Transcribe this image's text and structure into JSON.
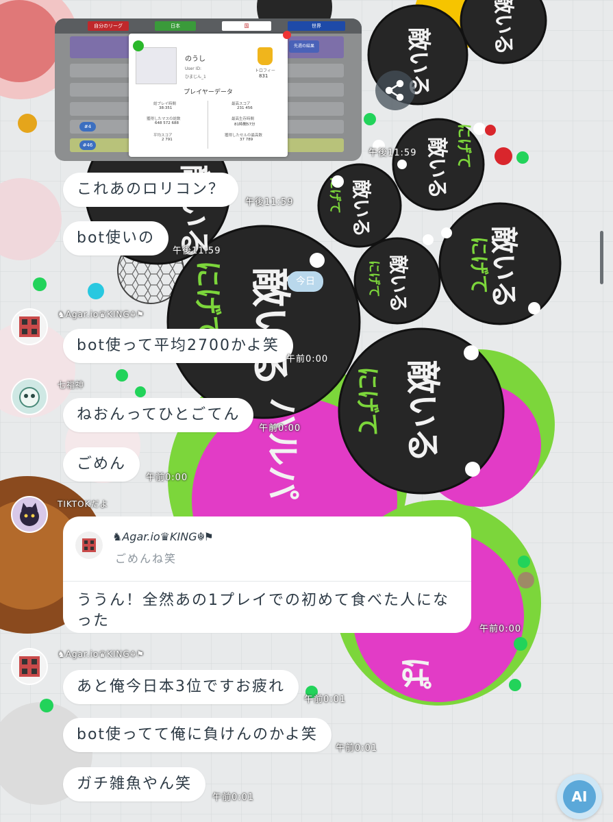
{
  "colors": {
    "bubble_bg": "#ffffff",
    "bubble_text": "#2d3a45",
    "enemy_cell": "#262626",
    "green_cell": "#7cd63b",
    "magenta": "#e23cc6",
    "ai_button": "#5ba8d9"
  },
  "background": {
    "cell_label": "敵いる",
    "cell_sub": "にげて",
    "cell_sub2": "ハルパ"
  },
  "screenshot": {
    "tabs": [
      "自分のリーグ",
      "日本",
      "国",
      "世界"
    ],
    "popup": {
      "name": "のうし",
      "user_id_label": "User ID:",
      "user_id_value": "ひまじん_1",
      "trophy_label": "トロフィー",
      "trophy_value": "831",
      "title": "プレイヤーデータ",
      "stats": [
        {
          "label": "総プレイ時間",
          "value": "38:351"
        },
        {
          "label": "最高スコア",
          "value": "231 456"
        },
        {
          "label": "獲得したマスの総数",
          "value": "648 572 688"
        },
        {
          "label": "最高生存時間",
          "value": "81時間57分"
        },
        {
          "label": "平均スコア",
          "value": "2 791"
        },
        {
          "label": "獲得したセルの最高数",
          "value": "37 789"
        }
      ]
    },
    "ranks": [
      "#4",
      "#46"
    ],
    "side_label": "先週の結果"
  },
  "messages": {
    "m1": {
      "text": "これあのロリコン？",
      "time": "午後11:59"
    },
    "shot_time": "午後11:59",
    "m2": {
      "text": "bot使いの",
      "time": "午後11:59"
    },
    "date_sep": "今日",
    "m3": {
      "sender": "♞Agar.io♛KING☬⚑",
      "text": "bot使って平均2700かよ笑",
      "time": "午前0:00"
    },
    "m4": {
      "sender": "七福神",
      "text": "ねおんってひとごてん",
      "time": "午前0:00"
    },
    "m5": {
      "text": "ごめん",
      "time": "午前0:00"
    },
    "m6": {
      "sender": "TIKTOKだよ",
      "quote_name": "♞Agar.io♛KING☬⚑",
      "quote_text": "ごめんね笑",
      "text": "ううん！全然あの1プレイでの初めて食べた人になった",
      "time": "午前0:00"
    },
    "m7": {
      "sender": "♞Agar.io♛KING☬⚑",
      "text": "あと俺今日本3位ですお疲れ",
      "time": "午前0:01"
    },
    "m8": {
      "text": "bot使ってて俺に負けんのかよ笑",
      "time": "午前0:01"
    },
    "m9": {
      "text": "ガチ雑魚やん笑",
      "time": "午前0:01"
    }
  },
  "buttons": {
    "ai_label": "AI",
    "share_icon": "share-icon"
  }
}
